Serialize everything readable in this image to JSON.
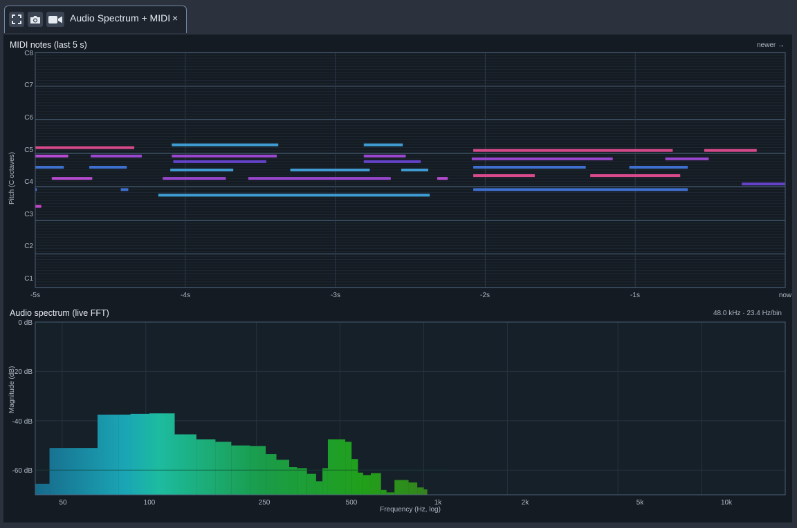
{
  "tab": {
    "title": "Audio Spectrum + MIDI",
    "close_label": "×",
    "icons": [
      "fullscreen-icon",
      "camera-icon",
      "video-icon"
    ]
  },
  "midi": {
    "title": "MIDI notes (last 5 s)",
    "newer_label": "newer →",
    "ylabel": "Pitch (C octaves)",
    "octave_labels": [
      "C8",
      "C7",
      "C6",
      "C5",
      "C4",
      "C3",
      "C2",
      "C1"
    ],
    "time_labels": [
      "-5s",
      "-4s",
      "-3s",
      "-2s",
      "-1s",
      "now"
    ]
  },
  "spectrum": {
    "title": "Audio spectrum (live FFT)",
    "info": "48.0 kHz · 23.4 Hz/bin",
    "ylabel": "Magnitude (dB)",
    "xlabel": "Frequency (Hz, log)",
    "y_ticks": [
      "0 dB",
      "-20 dB",
      "-40 dB",
      "-60 dB"
    ],
    "x_ticks": [
      "50",
      "100",
      "250",
      "500",
      "1k",
      "2k",
      "5k",
      "10k"
    ]
  },
  "chart_data": [
    {
      "type": "bar",
      "title": "MIDI notes (last 5 s)",
      "x_unit": "seconds relative to now",
      "y_unit": "MIDI note number",
      "xlim": [
        -5,
        0
      ],
      "ylim": [
        24,
        108
      ],
      "notes": [
        {
          "start": -5.0,
          "end": -4.34,
          "pitch": 74,
          "color": "#d94a8c"
        },
        {
          "start": -5.0,
          "end": -4.78,
          "pitch": 71,
          "color": "#b54bd1"
        },
        {
          "start": -4.63,
          "end": -4.29,
          "pitch": 71,
          "color": "#9a47d0"
        },
        {
          "start": -4.09,
          "end": -3.39,
          "pitch": 71,
          "color": "#9a47d0"
        },
        {
          "start": -2.81,
          "end": -2.53,
          "pitch": 71,
          "color": "#9a47d0"
        },
        {
          "start": -4.09,
          "end": -3.38,
          "pitch": 75,
          "color": "#3f9bd1"
        },
        {
          "start": -2.81,
          "end": -2.55,
          "pitch": 75,
          "color": "#3f9bd1"
        },
        {
          "start": -4.08,
          "end": -3.46,
          "pitch": 69,
          "color": "#6443c9"
        },
        {
          "start": -2.81,
          "end": -2.43,
          "pitch": 69,
          "color": "#6443c9"
        },
        {
          "start": -5.0,
          "end": -4.81,
          "pitch": 67,
          "color": "#3f6fcf"
        },
        {
          "start": -4.64,
          "end": -4.39,
          "pitch": 67,
          "color": "#3f6fcf"
        },
        {
          "start": -4.1,
          "end": -3.68,
          "pitch": 66,
          "color": "#3f9bd1"
        },
        {
          "start": -3.3,
          "end": -2.77,
          "pitch": 66,
          "color": "#3f9bd1"
        },
        {
          "start": -2.56,
          "end": -2.38,
          "pitch": 66,
          "color": "#3f9bd1"
        },
        {
          "start": -4.89,
          "end": -4.62,
          "pitch": 63,
          "color": "#b54bd1"
        },
        {
          "start": -4.15,
          "end": -3.73,
          "pitch": 63,
          "color": "#9a47d0"
        },
        {
          "start": -3.58,
          "end": -2.63,
          "pitch": 63,
          "color": "#9a47d0"
        },
        {
          "start": -2.32,
          "end": -2.25,
          "pitch": 63,
          "color": "#b54bd1"
        },
        {
          "start": -5.0,
          "end": -4.99,
          "pitch": 59,
          "color": "#3f6fcf"
        },
        {
          "start": -4.43,
          "end": -4.38,
          "pitch": 59,
          "color": "#3f6fcf"
        },
        {
          "start": -4.18,
          "end": -2.37,
          "pitch": 57,
          "color": "#3f9bd1"
        },
        {
          "start": -5.0,
          "end": -4.96,
          "pitch": 53,
          "color": "#c247c9"
        },
        {
          "start": -2.08,
          "end": -0.75,
          "pitch": 73,
          "color": "#d94a8c"
        },
        {
          "start": -0.54,
          "end": -0.19,
          "pitch": 73,
          "color": "#d94a8c"
        },
        {
          "start": -2.09,
          "end": -1.15,
          "pitch": 70,
          "color": "#9a47d0"
        },
        {
          "start": -0.8,
          "end": -0.51,
          "pitch": 70,
          "color": "#9a47d0"
        },
        {
          "start": -2.08,
          "end": -1.33,
          "pitch": 67,
          "color": "#3f6fcf"
        },
        {
          "start": -1.04,
          "end": -0.65,
          "pitch": 67,
          "color": "#3f6fcf"
        },
        {
          "start": -2.08,
          "end": -1.67,
          "pitch": 64,
          "color": "#d94a8c"
        },
        {
          "start": -1.3,
          "end": -0.7,
          "pitch": 64,
          "color": "#d94a8c"
        },
        {
          "start": -2.08,
          "end": -0.65,
          "pitch": 59,
          "color": "#3f6fcf"
        },
        {
          "start": -0.29,
          "end": 0.0,
          "pitch": 61,
          "color": "#6443c9"
        }
      ]
    },
    {
      "type": "bar",
      "title": "Audio spectrum (live FFT)",
      "xlabel": "Frequency (Hz, log)",
      "ylabel": "Magnitude (dB)",
      "x_scale": "log",
      "xlim": [
        40,
        20000
      ],
      "ylim": [
        -70,
        0
      ],
      "bins": [
        {
          "f0": 40,
          "f1": 45,
          "db": -65.5
        },
        {
          "f0": 45,
          "f1": 67,
          "db": -51
        },
        {
          "f0": 67,
          "f1": 80,
          "db": -37.5
        },
        {
          "f0": 80,
          "f1": 88,
          "db": -37.5
        },
        {
          "f0": 88,
          "f1": 103,
          "db": -37.2
        },
        {
          "f0": 103,
          "f1": 127,
          "db": -37
        },
        {
          "f0": 127,
          "f1": 152,
          "db": -45.5
        },
        {
          "f0": 152,
          "f1": 178,
          "db": -47.5
        },
        {
          "f0": 178,
          "f1": 203,
          "db": -48.5
        },
        {
          "f0": 203,
          "f1": 237,
          "db": -50
        },
        {
          "f0": 237,
          "f1": 270,
          "db": -50.2
        },
        {
          "f0": 270,
          "f1": 295,
          "db": -53.5
        },
        {
          "f0": 295,
          "f1": 328,
          "db": -55.8
        },
        {
          "f0": 328,
          "f1": 350,
          "db": -58.8
        },
        {
          "f0": 350,
          "f1": 380,
          "db": -59.2
        },
        {
          "f0": 380,
          "f1": 410,
          "db": -61.5
        },
        {
          "f0": 410,
          "f1": 432,
          "db": -64.5
        },
        {
          "f0": 432,
          "f1": 452,
          "db": -59.2
        },
        {
          "f0": 452,
          "f1": 522,
          "db": -47.5
        },
        {
          "f0": 522,
          "f1": 550,
          "db": -48.5
        },
        {
          "f0": 550,
          "f1": 580,
          "db": -55.5
        },
        {
          "f0": 580,
          "f1": 605,
          "db": -61
        },
        {
          "f0": 605,
          "f1": 645,
          "db": -62
        },
        {
          "f0": 645,
          "f1": 702,
          "db": -61.2
        },
        {
          "f0": 702,
          "f1": 735,
          "db": -68
        },
        {
          "f0": 735,
          "f1": 785,
          "db": -69
        },
        {
          "f0": 785,
          "f1": 882,
          "db": -64
        },
        {
          "f0": 882,
          "f1": 948,
          "db": -65
        },
        {
          "f0": 948,
          "f1": 1000,
          "db": -67
        },
        {
          "f0": 1000,
          "f1": 1030,
          "db": -67.8
        }
      ]
    }
  ]
}
